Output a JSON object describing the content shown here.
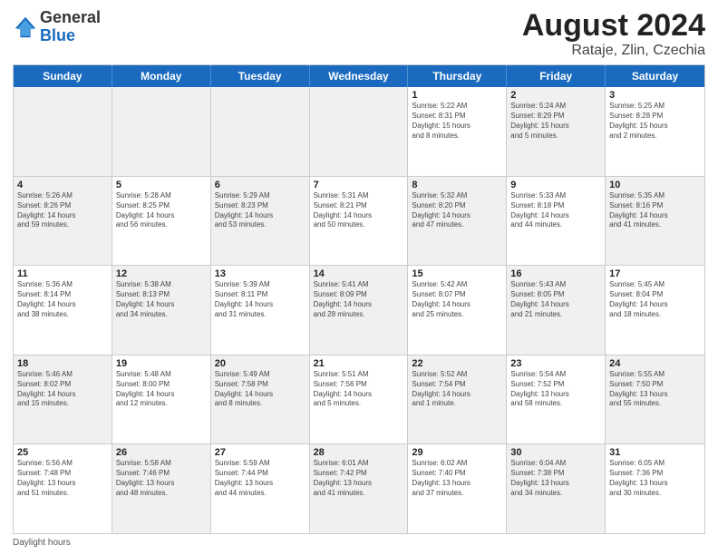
{
  "header": {
    "logo_general": "General",
    "logo_blue": "Blue",
    "month_title": "August 2024",
    "subtitle": "Rataje, Zlin, Czechia"
  },
  "days_of_week": [
    "Sunday",
    "Monday",
    "Tuesday",
    "Wednesday",
    "Thursday",
    "Friday",
    "Saturday"
  ],
  "footer": {
    "daylight_label": "Daylight hours"
  },
  "weeks": [
    [
      {
        "day": "",
        "info": "",
        "shaded": true
      },
      {
        "day": "",
        "info": "",
        "shaded": true
      },
      {
        "day": "",
        "info": "",
        "shaded": true
      },
      {
        "day": "",
        "info": "",
        "shaded": true
      },
      {
        "day": "1",
        "info": "Sunrise: 5:22 AM\nSunset: 8:31 PM\nDaylight: 15 hours\nand 8 minutes."
      },
      {
        "day": "2",
        "info": "Sunrise: 5:24 AM\nSunset: 8:29 PM\nDaylight: 15 hours\nand 5 minutes.",
        "shaded": true
      },
      {
        "day": "3",
        "info": "Sunrise: 5:25 AM\nSunset: 8:28 PM\nDaylight: 15 hours\nand 2 minutes."
      }
    ],
    [
      {
        "day": "4",
        "info": "Sunrise: 5:26 AM\nSunset: 8:26 PM\nDaylight: 14 hours\nand 59 minutes.",
        "shaded": true
      },
      {
        "day": "5",
        "info": "Sunrise: 5:28 AM\nSunset: 8:25 PM\nDaylight: 14 hours\nand 56 minutes."
      },
      {
        "day": "6",
        "info": "Sunrise: 5:29 AM\nSunset: 8:23 PM\nDaylight: 14 hours\nand 53 minutes.",
        "shaded": true
      },
      {
        "day": "7",
        "info": "Sunrise: 5:31 AM\nSunset: 8:21 PM\nDaylight: 14 hours\nand 50 minutes."
      },
      {
        "day": "8",
        "info": "Sunrise: 5:32 AM\nSunset: 8:20 PM\nDaylight: 14 hours\nand 47 minutes.",
        "shaded": true
      },
      {
        "day": "9",
        "info": "Sunrise: 5:33 AM\nSunset: 8:18 PM\nDaylight: 14 hours\nand 44 minutes."
      },
      {
        "day": "10",
        "info": "Sunrise: 5:35 AM\nSunset: 8:16 PM\nDaylight: 14 hours\nand 41 minutes.",
        "shaded": true
      }
    ],
    [
      {
        "day": "11",
        "info": "Sunrise: 5:36 AM\nSunset: 8:14 PM\nDaylight: 14 hours\nand 38 minutes."
      },
      {
        "day": "12",
        "info": "Sunrise: 5:38 AM\nSunset: 8:13 PM\nDaylight: 14 hours\nand 34 minutes.",
        "shaded": true
      },
      {
        "day": "13",
        "info": "Sunrise: 5:39 AM\nSunset: 8:11 PM\nDaylight: 14 hours\nand 31 minutes."
      },
      {
        "day": "14",
        "info": "Sunrise: 5:41 AM\nSunset: 8:09 PM\nDaylight: 14 hours\nand 28 minutes.",
        "shaded": true
      },
      {
        "day": "15",
        "info": "Sunrise: 5:42 AM\nSunset: 8:07 PM\nDaylight: 14 hours\nand 25 minutes."
      },
      {
        "day": "16",
        "info": "Sunrise: 5:43 AM\nSunset: 8:05 PM\nDaylight: 14 hours\nand 21 minutes.",
        "shaded": true
      },
      {
        "day": "17",
        "info": "Sunrise: 5:45 AM\nSunset: 8:04 PM\nDaylight: 14 hours\nand 18 minutes."
      }
    ],
    [
      {
        "day": "18",
        "info": "Sunrise: 5:46 AM\nSunset: 8:02 PM\nDaylight: 14 hours\nand 15 minutes.",
        "shaded": true
      },
      {
        "day": "19",
        "info": "Sunrise: 5:48 AM\nSunset: 8:00 PM\nDaylight: 14 hours\nand 12 minutes."
      },
      {
        "day": "20",
        "info": "Sunrise: 5:49 AM\nSunset: 7:58 PM\nDaylight: 14 hours\nand 8 minutes.",
        "shaded": true
      },
      {
        "day": "21",
        "info": "Sunrise: 5:51 AM\nSunset: 7:56 PM\nDaylight: 14 hours\nand 5 minutes."
      },
      {
        "day": "22",
        "info": "Sunrise: 5:52 AM\nSunset: 7:54 PM\nDaylight: 14 hours\nand 1 minute.",
        "shaded": true
      },
      {
        "day": "23",
        "info": "Sunrise: 5:54 AM\nSunset: 7:52 PM\nDaylight: 13 hours\nand 58 minutes."
      },
      {
        "day": "24",
        "info": "Sunrise: 5:55 AM\nSunset: 7:50 PM\nDaylight: 13 hours\nand 55 minutes.",
        "shaded": true
      }
    ],
    [
      {
        "day": "25",
        "info": "Sunrise: 5:56 AM\nSunset: 7:48 PM\nDaylight: 13 hours\nand 51 minutes."
      },
      {
        "day": "26",
        "info": "Sunrise: 5:58 AM\nSunset: 7:46 PM\nDaylight: 13 hours\nand 48 minutes.",
        "shaded": true
      },
      {
        "day": "27",
        "info": "Sunrise: 5:59 AM\nSunset: 7:44 PM\nDaylight: 13 hours\nand 44 minutes."
      },
      {
        "day": "28",
        "info": "Sunrise: 6:01 AM\nSunset: 7:42 PM\nDaylight: 13 hours\nand 41 minutes.",
        "shaded": true
      },
      {
        "day": "29",
        "info": "Sunrise: 6:02 AM\nSunset: 7:40 PM\nDaylight: 13 hours\nand 37 minutes."
      },
      {
        "day": "30",
        "info": "Sunrise: 6:04 AM\nSunset: 7:38 PM\nDaylight: 13 hours\nand 34 minutes.",
        "shaded": true
      },
      {
        "day": "31",
        "info": "Sunrise: 6:05 AM\nSunset: 7:36 PM\nDaylight: 13 hours\nand 30 minutes."
      }
    ]
  ]
}
